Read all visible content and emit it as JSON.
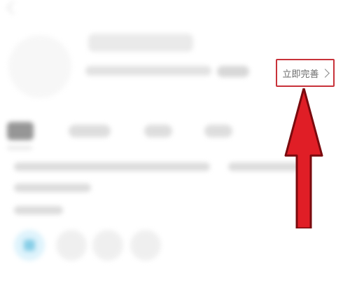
{
  "profile": {
    "complete_button_label": "立即完善"
  },
  "colors": {
    "highlight_border": "#c8323a",
    "arrow": "#e01e26"
  }
}
